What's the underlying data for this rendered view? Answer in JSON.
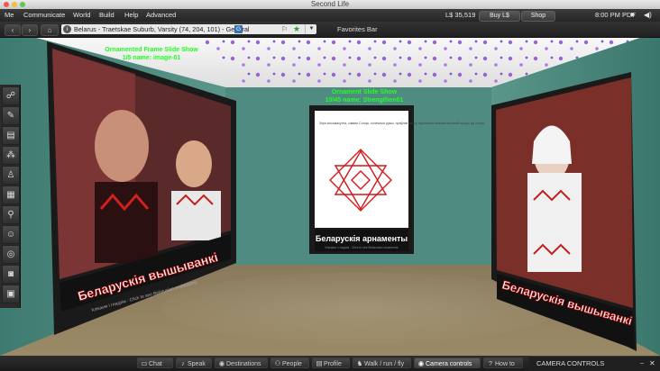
{
  "window": {
    "title": "Second Life"
  },
  "menubar": {
    "items": [
      "Me",
      "Communicate",
      "World",
      "Build",
      "Help",
      "Advanced"
    ],
    "balance": "L$ 35,519",
    "buy_label": "Buy L$",
    "shop_label": "Shop",
    "clock": "8:00 PM PDT"
  },
  "navbar": {
    "location": "Belarus - Traetskae Suburb, Varsity (74, 204, 101) - General",
    "maturity_badge": "G",
    "favorites_label": "Favorites Bar"
  },
  "scene": {
    "hover_left_title": "Ornamented Frame Slide Show",
    "hover_left_sub": "1/5 name: image-01",
    "hover_center_title": "Ornament Slide Show",
    "hover_center_sub": "10/45 name: Strengthen01",
    "left_panel_caption": "Беларускія вышыванкі",
    "left_panel_sub": "Клікаем і глядзім - Click to see Belarusian embroidery",
    "center_panel_caption": "Беларускія арнаменты",
    "center_panel_sub": "Клікаем і глядзім - Click to see Belarusian ornaments",
    "center_panel_text": "Зоря восьмикутна, сімвал Сонца, сонечныя ружы, праўляе ручку, адзначана знакам высокай працы ад сонца.",
    "right_panel_caption": "Беларускія вышыванкі"
  },
  "bottombar": {
    "buttons": [
      {
        "label": "Chat",
        "icon": "chat-bubble-icon"
      },
      {
        "label": "Speak",
        "icon": "microphone-icon"
      },
      {
        "label": "Destinations",
        "icon": "map-pin-icon"
      },
      {
        "label": "People",
        "icon": "people-icon"
      },
      {
        "label": "Profile",
        "icon": "id-card-icon"
      },
      {
        "label": "Walk / run / fly",
        "icon": "walking-person-icon"
      },
      {
        "label": "Camera controls",
        "icon": "eye-icon"
      },
      {
        "label": "How to",
        "icon": "question-icon"
      }
    ]
  },
  "camera_panel": {
    "title": "CAMERA CONTROLS"
  },
  "left_toolbar": {
    "icons": [
      "gesture-icon",
      "pin-icon",
      "map-icon",
      "footprints-icon",
      "appearance-icon",
      "inventory-icon",
      "search-icon",
      "avatar-icon",
      "radar-icon",
      "snapshot-icon",
      "notice-icon"
    ]
  },
  "colors": {
    "accent": "#3a6fb0",
    "wall": "#4f8b80",
    "floor": "#8d7a5e",
    "ceiling": "#eeeeee",
    "hover_text": "#22ff22"
  }
}
